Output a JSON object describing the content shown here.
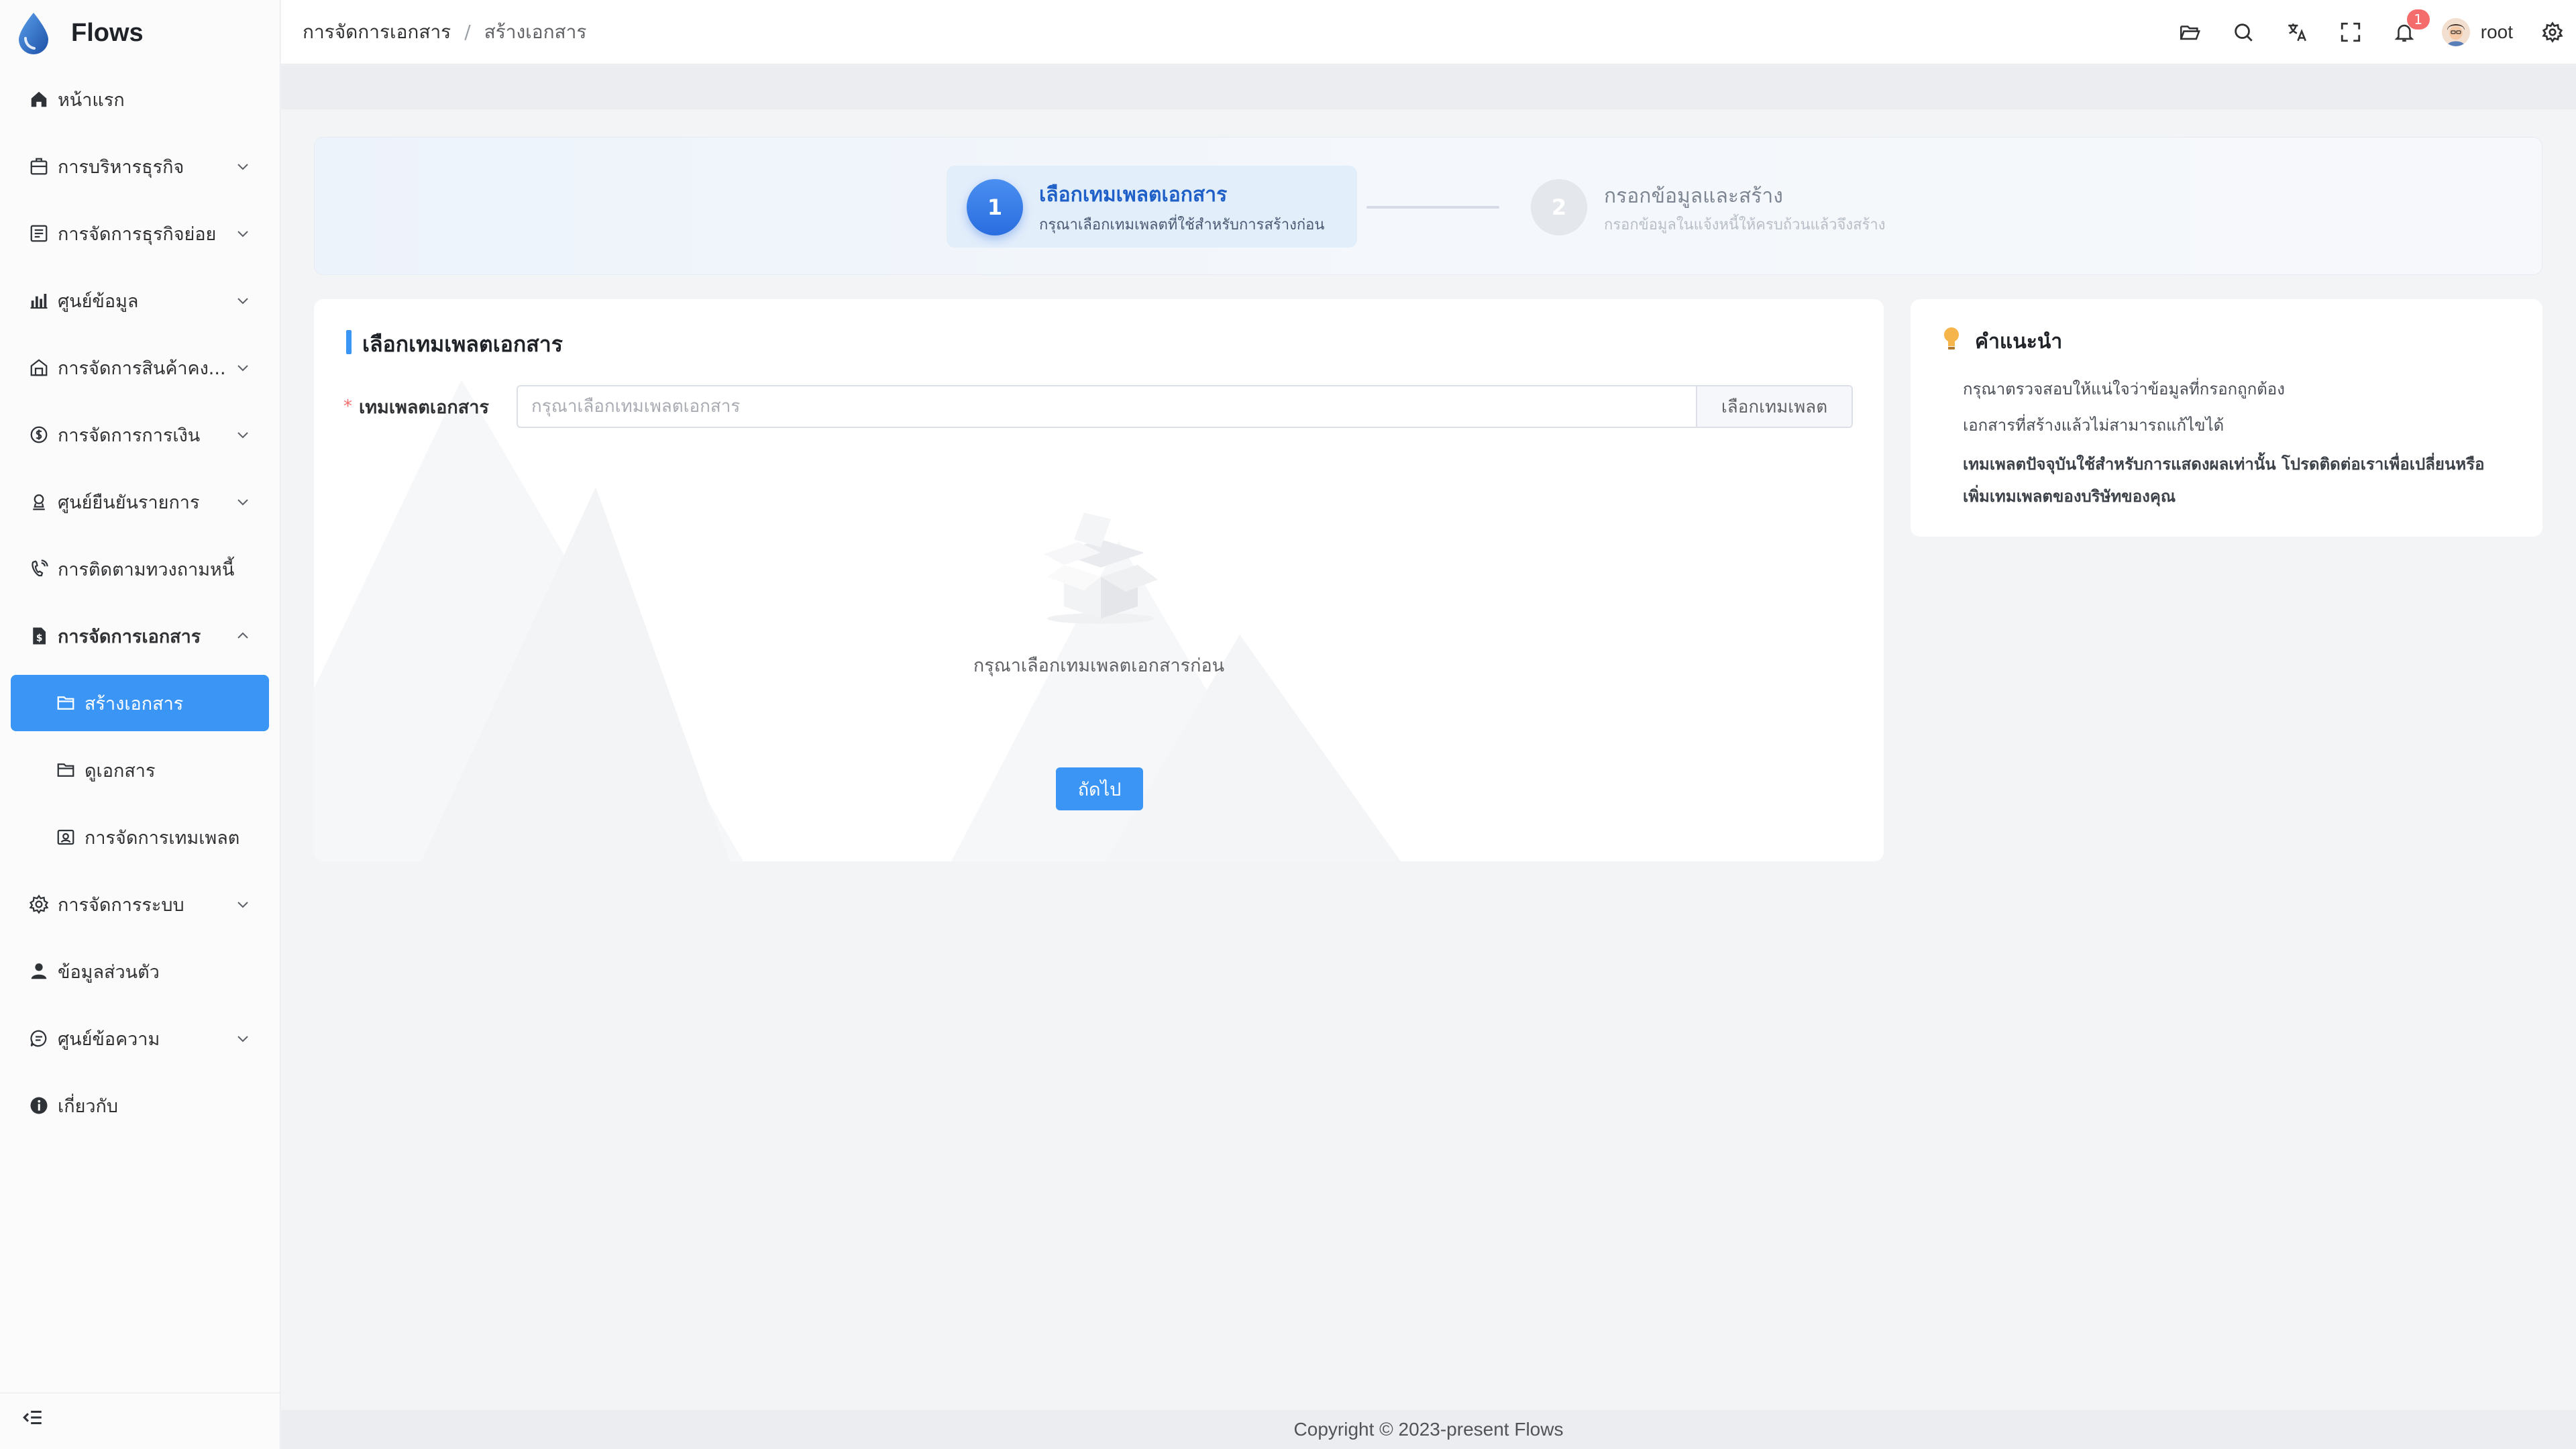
{
  "brand": {
    "name": "Flows",
    "accent": "#3b95f5"
  },
  "sidebar": {
    "items": [
      {
        "label": "หน้าแรก",
        "icon": "home-icon"
      },
      {
        "label": "การบริหารธุรกิจ",
        "icon": "business-icon",
        "expandable": true
      },
      {
        "label": "การจัดการธุรกิจย่อย",
        "icon": "sub-business-icon",
        "expandable": true
      },
      {
        "label": "ศูนย์ข้อมูล",
        "icon": "bar-chart-icon",
        "expandable": true
      },
      {
        "label": "การจัดการสินค้าคง...",
        "icon": "warehouse-icon",
        "expandable": true
      },
      {
        "label": "การจัดการการเงิน",
        "icon": "money-icon",
        "expandable": true
      },
      {
        "label": "ศูนย์ยืนยันรายการ",
        "icon": "verify-icon",
        "expandable": true
      },
      {
        "label": "การติดตามทวงถามหนี้",
        "icon": "phone-icon"
      },
      {
        "label": "การจัดการเอกสาร",
        "icon": "document-icon",
        "expandable": true,
        "open": true
      },
      {
        "label": "การจัดการระบบ",
        "icon": "gear-icon",
        "expandable": true
      },
      {
        "label": "ข้อมูลส่วนตัว",
        "icon": "user-icon"
      },
      {
        "label": "ศูนย์ข้อความ",
        "icon": "message-icon",
        "expandable": true
      },
      {
        "label": "เกี่ยวกับ",
        "icon": "info-icon"
      }
    ],
    "doc_submenu": [
      {
        "label": "สร้างเอกสาร",
        "icon": "folder-add-icon",
        "active": true
      },
      {
        "label": "ดูเอกสาร",
        "icon": "folder-icon"
      },
      {
        "label": "การจัดการเทมเพลต",
        "icon": "template-icon"
      }
    ]
  },
  "header": {
    "breadcrumb": [
      "การจัดการเอกสาร",
      "สร้างเอกสาร"
    ],
    "breadcrumb_sep": "/",
    "notification_count": "1",
    "username": "root"
  },
  "steps": [
    {
      "number": "1",
      "title": "เลือกเทมเพลตเอกสาร",
      "desc": "กรุณาเลือกเทมเพลตที่ใช้สำหรับการสร้างก่อน",
      "active": true
    },
    {
      "number": "2",
      "title": "กรอกข้อมูลและสร้าง",
      "desc": "กรอกข้อมูลในแจ้งหนี้ให้ครบถ้วนแล้วจึงสร้าง",
      "active": false
    }
  ],
  "form": {
    "section_title": "เลือกเทมเพลตเอกสาร",
    "required_mark": "*",
    "template_label": "เทมเพลตเอกสาร",
    "template_placeholder": "กรุณาเลือกเทมเพลตเอกสาร",
    "template_value": "",
    "select_button": "เลือกเทมเพลต",
    "empty_text": "กรุณาเลือกเทมเพลตเอกสารก่อน",
    "next_button": "ถัดไป"
  },
  "tips": {
    "title": "คำแนะนำ",
    "items": [
      "กรุณาตรวจสอบให้แน่ใจว่าข้อมูลที่กรอกถูกต้อง",
      "เอกสารที่สร้างแล้วไม่สามารถแก้ไขได้",
      "เทมเพลตปัจจุบันใช้สำหรับการแสดงผลเท่านั้น โปรดติดต่อเราเพื่อเปลี่ยนหรือเพิ่มเทมเพลตของบริษัทของคุณ"
    ]
  },
  "footer": {
    "copyright": "Copyright © 2023-present Flows"
  }
}
